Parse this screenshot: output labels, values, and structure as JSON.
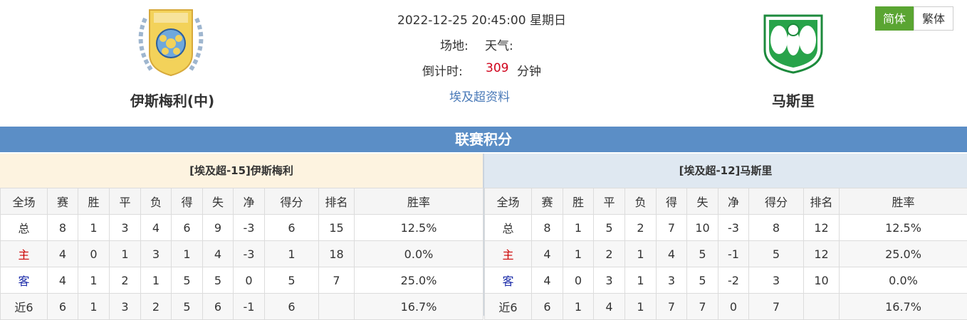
{
  "match": {
    "datetime": "2022-12-25 20:45:00 星期日",
    "venue_label": "场地:",
    "weather_label": "天气:",
    "countdown_label": "倒计时:",
    "countdown_value": "309",
    "countdown_unit": "分钟",
    "league_link": "埃及超资料"
  },
  "home_team": {
    "name": "伊斯梅利(中)",
    "logo_icon": "ismaily-crest-icon"
  },
  "away_team": {
    "name": "马斯里",
    "logo_icon": "al-masry-crest-icon"
  },
  "lang": {
    "simplified": "简体",
    "traditional": "繁体",
    "active_color": "#5aa532"
  },
  "banner_title": "联赛积分",
  "colors": {
    "banner": "#5b8ec6",
    "home_header": "#fdf3e0",
    "away_header": "#dfe8f1",
    "home_row": "#cc0000",
    "away_row": "#1a2aa8",
    "countdown": "#d0021b"
  },
  "standings": {
    "columns": [
      "全场",
      "赛",
      "胜",
      "平",
      "负",
      "得",
      "失",
      "净",
      "得分",
      "排名",
      "胜率"
    ],
    "home": {
      "title": "[埃及超-15]伊斯梅利",
      "rows": [
        [
          "总",
          "8",
          "1",
          "3",
          "4",
          "6",
          "9",
          "-3",
          "6",
          "15",
          "12.5%"
        ],
        [
          "主",
          "4",
          "0",
          "1",
          "3",
          "1",
          "4",
          "-3",
          "1",
          "18",
          "0.0%"
        ],
        [
          "客",
          "4",
          "1",
          "2",
          "1",
          "5",
          "5",
          "0",
          "5",
          "7",
          "25.0%"
        ],
        [
          "近6",
          "6",
          "1",
          "3",
          "2",
          "5",
          "6",
          "-1",
          "6",
          "",
          "16.7%"
        ]
      ]
    },
    "away": {
      "title": "[埃及超-12]马斯里",
      "rows": [
        [
          "总",
          "8",
          "1",
          "5",
          "2",
          "7",
          "10",
          "-3",
          "8",
          "12",
          "12.5%"
        ],
        [
          "主",
          "4",
          "1",
          "2",
          "1",
          "4",
          "5",
          "-1",
          "5",
          "12",
          "25.0%"
        ],
        [
          "客",
          "4",
          "0",
          "3",
          "1",
          "3",
          "5",
          "-2",
          "3",
          "10",
          "0.0%"
        ],
        [
          "近6",
          "6",
          "1",
          "4",
          "1",
          "7",
          "7",
          "0",
          "7",
          "",
          "16.7%"
        ]
      ]
    }
  }
}
